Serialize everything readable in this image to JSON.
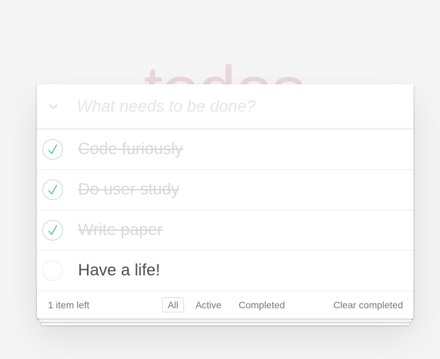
{
  "app": {
    "title": "todos"
  },
  "new_todo": {
    "placeholder": "What needs to be done?",
    "value": ""
  },
  "todos": [
    {
      "label": "Code furiously",
      "completed": true
    },
    {
      "label": "Do user study",
      "completed": true
    },
    {
      "label": "Write paper",
      "completed": true
    },
    {
      "label": "Have a life!",
      "completed": false
    }
  ],
  "footer": {
    "count_text": "1 item left",
    "filters": [
      {
        "label": "All",
        "selected": true
      },
      {
        "label": "Active",
        "selected": false
      },
      {
        "label": "Completed",
        "selected": false
      }
    ],
    "clear_label": "Clear completed"
  },
  "colors": {
    "title": "#af2f2f",
    "check": "#5dc2af",
    "check_border": "#bddad5",
    "completed_text": "#d9d9d9"
  },
  "icons": {
    "toggle_all": "chevron-down-icon",
    "check": "checkmark-icon"
  }
}
